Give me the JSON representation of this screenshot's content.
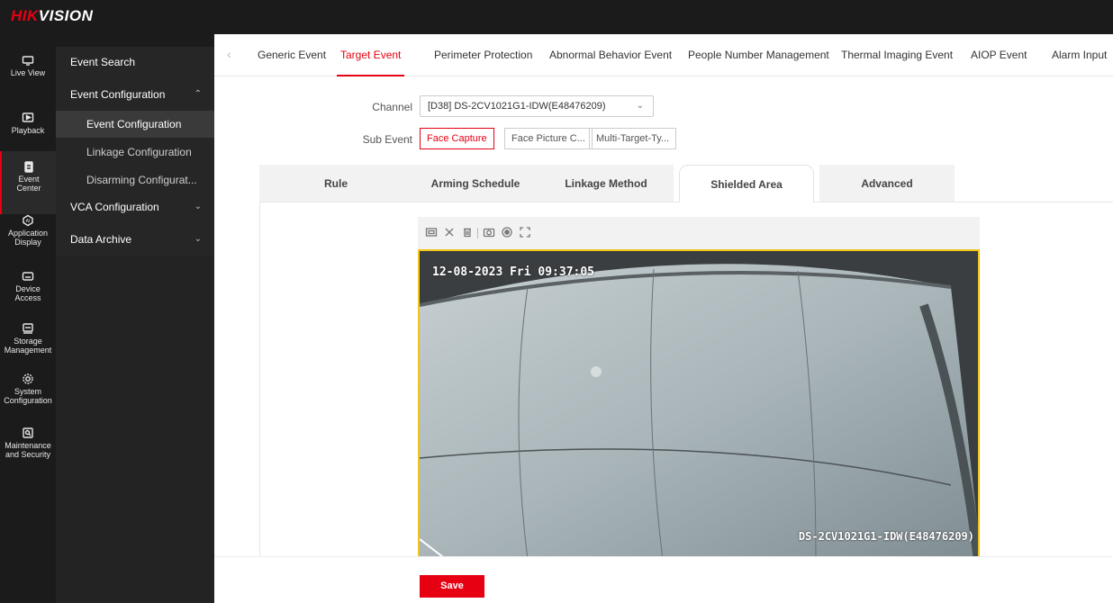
{
  "brand": {
    "hik": "HIK",
    "vision": "VISION"
  },
  "rail": [
    {
      "icon": "monitor-icon",
      "label": "Live View"
    },
    {
      "icon": "playback-icon",
      "label": "Playback"
    },
    {
      "icon": "clipboard-icon",
      "label": "Event Center"
    },
    {
      "icon": "ai-icon",
      "label": "Application Display"
    },
    {
      "icon": "device-icon",
      "label": "Device Access"
    },
    {
      "icon": "storage-icon",
      "label": "Storage Management"
    },
    {
      "icon": "gear-icon",
      "label": "System Configuration"
    },
    {
      "icon": "maintenance-icon",
      "label": "Maintenance and Security"
    }
  ],
  "submenu": {
    "event_search": "Event Search",
    "event_configuration": "Event Configuration",
    "items": [
      "Event Configuration",
      "Linkage Configuration",
      "Disarming Configurat..."
    ],
    "vca_configuration": "VCA Configuration",
    "data_archive": "Data Archive"
  },
  "tabs": [
    "Generic Event",
    "Target Event",
    "Perimeter Protection",
    "Abnormal Behavior Event",
    "People Number Management",
    "Thermal Imaging Event",
    "AIOP Event",
    "Alarm Input"
  ],
  "active_tab": "Target Event",
  "form": {
    "channel_label": "Channel",
    "channel_value": "[D38] DS-2CV1021G1-IDW(E48476209)",
    "sub_event_label": "Sub Event",
    "sub_events": [
      "Face Capture",
      "Face Picture C...",
      "Multi-Target-Ty..."
    ]
  },
  "config_tabs": [
    "Rule",
    "Arming Schedule",
    "Linkage Method",
    "Shielded Area",
    "Advanced"
  ],
  "active_config_tab": "Shielded Area",
  "video": {
    "timestamp": "12-08-2023 Fri 09:37:05",
    "camera_name": "DS-2CV1021G1-IDW(E48476209)"
  },
  "footer": {
    "save_label": "Save"
  },
  "colors": {
    "accent": "#e60012",
    "sidebar": "#1b1b1b",
    "highlight": "#f0c419"
  }
}
